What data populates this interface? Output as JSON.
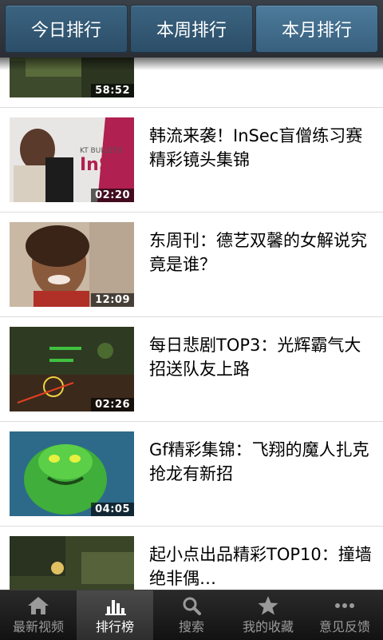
{
  "tabs": [
    {
      "label": "今日排行",
      "active": false
    },
    {
      "label": "本周排行",
      "active": false
    },
    {
      "label": "本月排行",
      "active": true
    }
  ],
  "videos": [
    {
      "title": "",
      "duration": "58:52"
    },
    {
      "title": "韩流来袭！InSec盲僧练习赛精彩镜头集锦",
      "duration": "02:20",
      "thumb_text": [
        "KT BULLETS",
        "InSec"
      ]
    },
    {
      "title": "东周刊：德艺双馨的女解说究竟是谁？",
      "duration": "12:09"
    },
    {
      "title": "每日悲剧TOP3：光辉霸气大招送队友上路",
      "duration": "02:26"
    },
    {
      "title": "Gf精彩集锦：飞翔的魔人扎克抢龙有新招",
      "duration": "04:05"
    },
    {
      "title": "起小点出品精彩TOP10：撞墙绝非偶…",
      "duration": ""
    }
  ],
  "bottom_nav": [
    {
      "label": "最新视频",
      "icon": "home-icon",
      "active": false
    },
    {
      "label": "排行榜",
      "icon": "bar-chart-icon",
      "active": true
    },
    {
      "label": "搜索",
      "icon": "search-icon",
      "active": false
    },
    {
      "label": "我的收藏",
      "icon": "star-icon",
      "active": false
    },
    {
      "label": "意见反馈",
      "icon": "more-dots-icon",
      "active": false
    }
  ],
  "colors": {
    "tab_bg": "#2c4e68",
    "tab_active_bg": "#38607e",
    "nav_bg": "#1a1a1a",
    "nav_active_bg": "#3a3a3a"
  }
}
